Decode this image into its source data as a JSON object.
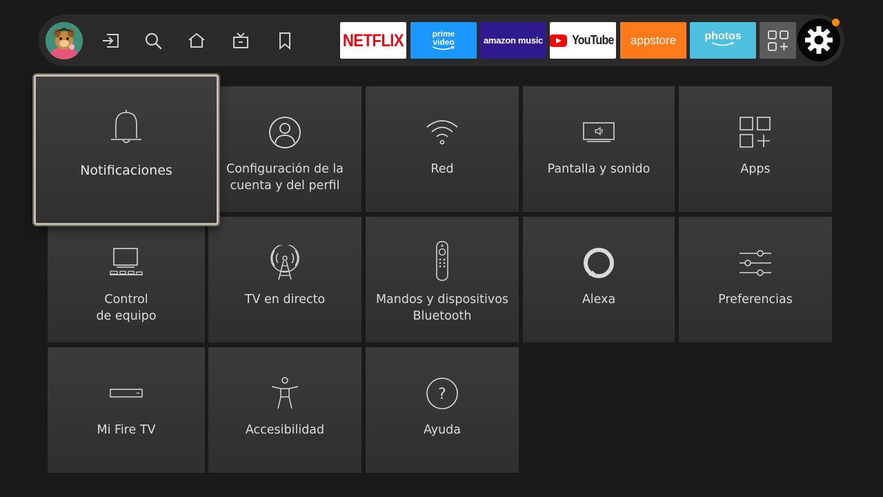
{
  "topbar": {
    "nav": [
      {
        "id": "inputs",
        "icon": "input-switch-icon"
      },
      {
        "id": "search",
        "icon": "search-icon"
      },
      {
        "id": "home",
        "icon": "home-icon"
      },
      {
        "id": "live",
        "icon": "live-tv-icon"
      },
      {
        "id": "watchlist",
        "icon": "bookmark-icon"
      }
    ],
    "apps": [
      {
        "id": "netflix",
        "label": "NETFLIX",
        "color": "#e50914"
      },
      {
        "id": "prime",
        "label": "prime\nvideo",
        "color": "#1a98ff"
      },
      {
        "id": "music",
        "label": "amazon music",
        "color": "#2f1a8f"
      },
      {
        "id": "youtube",
        "label": "YouTube",
        "color": "#ff0000"
      },
      {
        "id": "appstore",
        "label": "appstore",
        "color": "#ff7a1a"
      },
      {
        "id": "photos",
        "label": "photos",
        "color": "#4dbfdf"
      }
    ],
    "settings_icon": "gear-icon",
    "notification_dot_color": "#ff8a00"
  },
  "settings": {
    "items": [
      {
        "id": "notifications",
        "label": "Notificaciones",
        "icon": "bell-icon",
        "focused": true
      },
      {
        "id": "account",
        "label": "Configuración de la\ncuenta y del perfil",
        "icon": "user-circle-icon"
      },
      {
        "id": "network",
        "label": "Red",
        "icon": "wifi-icon"
      },
      {
        "id": "display",
        "label": "Pantalla y sonido",
        "icon": "display-sound-icon"
      },
      {
        "id": "apps",
        "label": "Apps",
        "icon": "apps-grid-icon"
      },
      {
        "id": "equipment",
        "label": "Control\nde equipo",
        "icon": "equipment-control-icon"
      },
      {
        "id": "livetv",
        "label": "TV en directo",
        "icon": "antenna-icon"
      },
      {
        "id": "remotes",
        "label": "Mandos y dispositivos\nBluetooth",
        "icon": "remote-icon"
      },
      {
        "id": "alexa",
        "label": "Alexa",
        "icon": "alexa-icon"
      },
      {
        "id": "preferences",
        "label": "Preferencias",
        "icon": "sliders-icon"
      },
      {
        "id": "myfiretv",
        "label": "Mi Fire TV",
        "icon": "fire-tv-device-icon"
      },
      {
        "id": "accessibility",
        "label": "Accesibilidad",
        "icon": "accessibility-icon"
      },
      {
        "id": "help",
        "label": "Ayuda",
        "icon": "help-icon"
      }
    ]
  }
}
